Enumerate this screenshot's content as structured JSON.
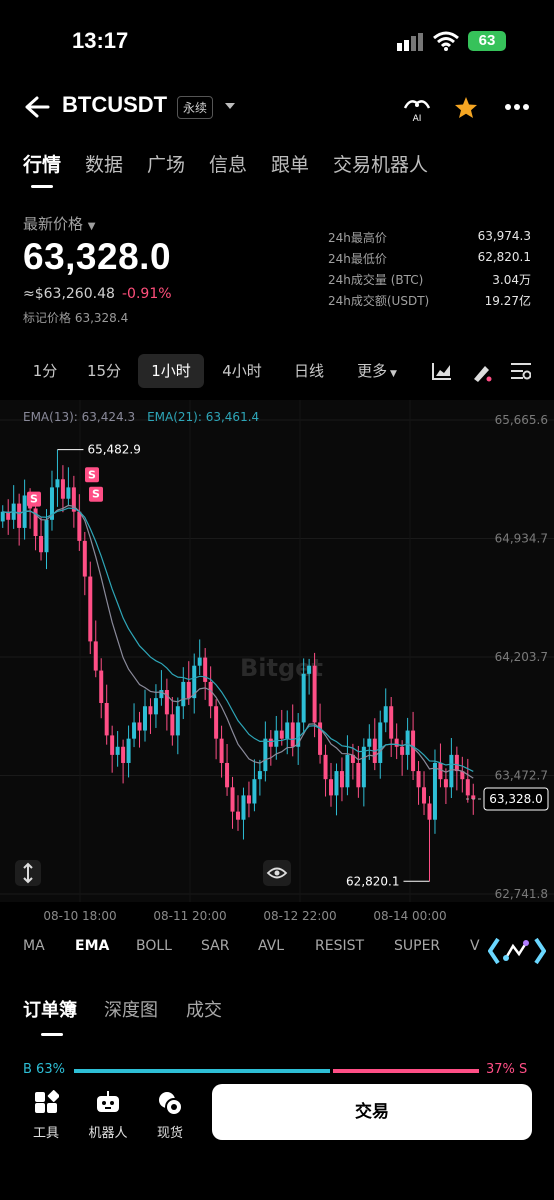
{
  "status_bar": {
    "time": "13:17",
    "battery": "63"
  },
  "header": {
    "symbol": "BTCUSDT",
    "contract_type": "永续",
    "ai_label": "AI"
  },
  "main_tabs": [
    "行情",
    "数据",
    "广场",
    "信息",
    "跟单",
    "交易机器人"
  ],
  "price": {
    "label": "最新价格",
    "last": "63,328.0",
    "approx": "≈$63,260.48",
    "change": "-0.91%",
    "mark_label": "标记价格 63,328.4"
  },
  "stats": [
    {
      "label": "24h最高价",
      "value": "63,974.3"
    },
    {
      "label": "24h最低价",
      "value": "62,820.1"
    },
    {
      "label": "24h成交量 (BTC)",
      "value": "3.04万"
    },
    {
      "label": "24h成交额(USDT)",
      "value": "19.27亿"
    }
  ],
  "intervals": [
    "1分",
    "15分",
    "1小时",
    "4小时",
    "日线",
    "更多"
  ],
  "active_interval": "1小时",
  "chart": {
    "ema13_label": "EMA(13): 63,424.3",
    "ema21_label": "EMA(21): 63,461.4",
    "watermark": "Bitget",
    "high_label": "65,482.9",
    "low_label": "62,820.1",
    "current_label": "63,328.0",
    "signal_marker": "S",
    "price_axis": [
      "65,665.6",
      "64,934.7",
      "64,203.7",
      "63,472.7",
      "62,741.8"
    ],
    "time_axis": [
      "08-10 18:00",
      "08-11 20:00",
      "08-12 22:00",
      "08-14 00:00"
    ],
    "colors": {
      "up": "#2ebfd6",
      "down": "#ff4f86",
      "ema13": "#8a8a9a",
      "ema21": "#2ea6b8"
    }
  },
  "chart_data": {
    "type": "candlestick",
    "price_range": [
      62741.8,
      65665.6
    ],
    "high": 65482.9,
    "low": 62820.1,
    "last": 63328.0,
    "closes": [
      65100,
      65050,
      65150,
      65000,
      65200,
      65120,
      64950,
      64850,
      65050,
      65250,
      65300,
      65180,
      65250,
      65100,
      64920,
      64700,
      64300,
      64120,
      63920,
      63720,
      63600,
      63650,
      63550,
      63700,
      63800,
      63750,
      63900,
      63850,
      63950,
      64000,
      63850,
      63720,
      63900,
      64050,
      63950,
      64150,
      64200,
      64050,
      63900,
      63700,
      63550,
      63400,
      63250,
      63200,
      63350,
      63300,
      63450,
      63500,
      63700,
      63650,
      63750,
      63700,
      63800,
      63650,
      63800,
      64100,
      64150,
      63800,
      63600,
      63450,
      63350,
      63500,
      63400,
      63600,
      63550,
      63400,
      63650,
      63700,
      63550,
      63800,
      63900,
      63700,
      63650,
      63600,
      63750,
      63500,
      63400,
      63300,
      63200,
      63550,
      63450,
      63400,
      63600,
      63500,
      63450,
      63350,
      63328
    ]
  },
  "indicator_tabs": [
    "MA",
    "EMA",
    "BOLL",
    "SAR",
    "AVL",
    "RESIST",
    "SUPER",
    "V"
  ],
  "active_indicator": "EMA",
  "orderbook_tabs": [
    "订单簿",
    "深度图",
    "成交"
  ],
  "orderbook_ratio": {
    "buy": "B 63%",
    "sell": "37% S"
  },
  "bottom_nav": [
    {
      "label": "工具",
      "icon": "tools-icon"
    },
    {
      "label": "机器人",
      "icon": "robot-icon"
    },
    {
      "label": "现货",
      "icon": "spot-icon"
    }
  ],
  "trade_button": "交易"
}
